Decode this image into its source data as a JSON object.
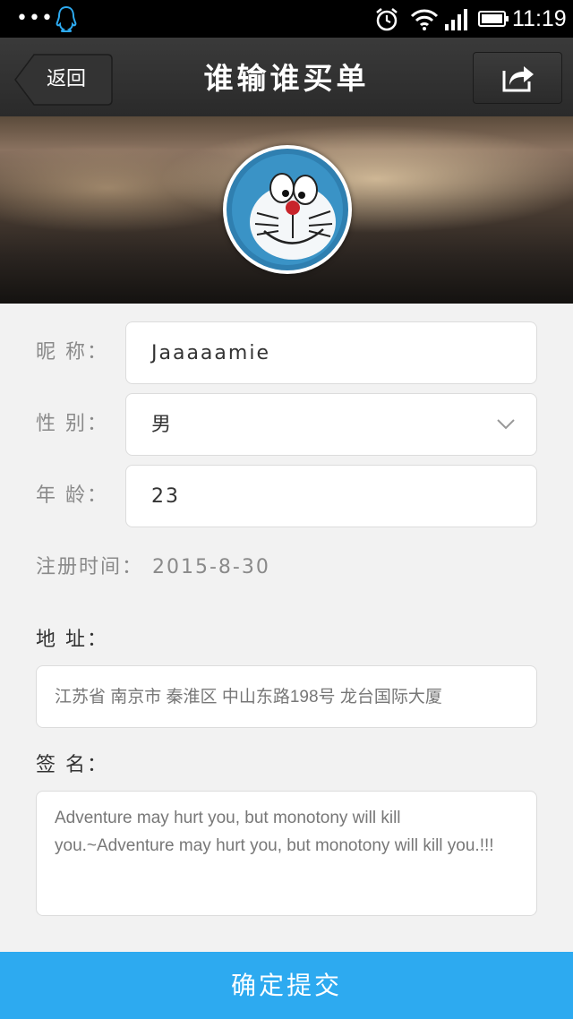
{
  "status_bar": {
    "dots": "•••",
    "time": "11:19",
    "icons": [
      "qq-icon",
      "alarm-icon",
      "wifi-icon",
      "signal-icon",
      "battery-icon"
    ]
  },
  "nav": {
    "back_label": "返回",
    "title": "谁输谁买单",
    "share_icon": "share-icon"
  },
  "form": {
    "nickname_label": "昵 称：",
    "nickname_value": "Jaaaaamie",
    "gender_label": "性 别：",
    "gender_value": "男",
    "age_label": "年 龄：",
    "age_value": "23",
    "reg_label": "注册时间：",
    "reg_value": "2015-8-30",
    "address_label": "地 址：",
    "address_value": "江苏省 南京市 秦淮区 中山东路198号 龙台国际大厦",
    "signature_label": "签 名：",
    "signature_line1": "Adventure may hurt you, but monotony will kill",
    "signature_line2": "you.~Adventure may hurt you, but monotony will kill you.!!!"
  },
  "submit_label": "确定提交",
  "colors": {
    "accent": "#2daaf0",
    "navbar": "#2f2f2f",
    "background": "#f2f2f2"
  }
}
